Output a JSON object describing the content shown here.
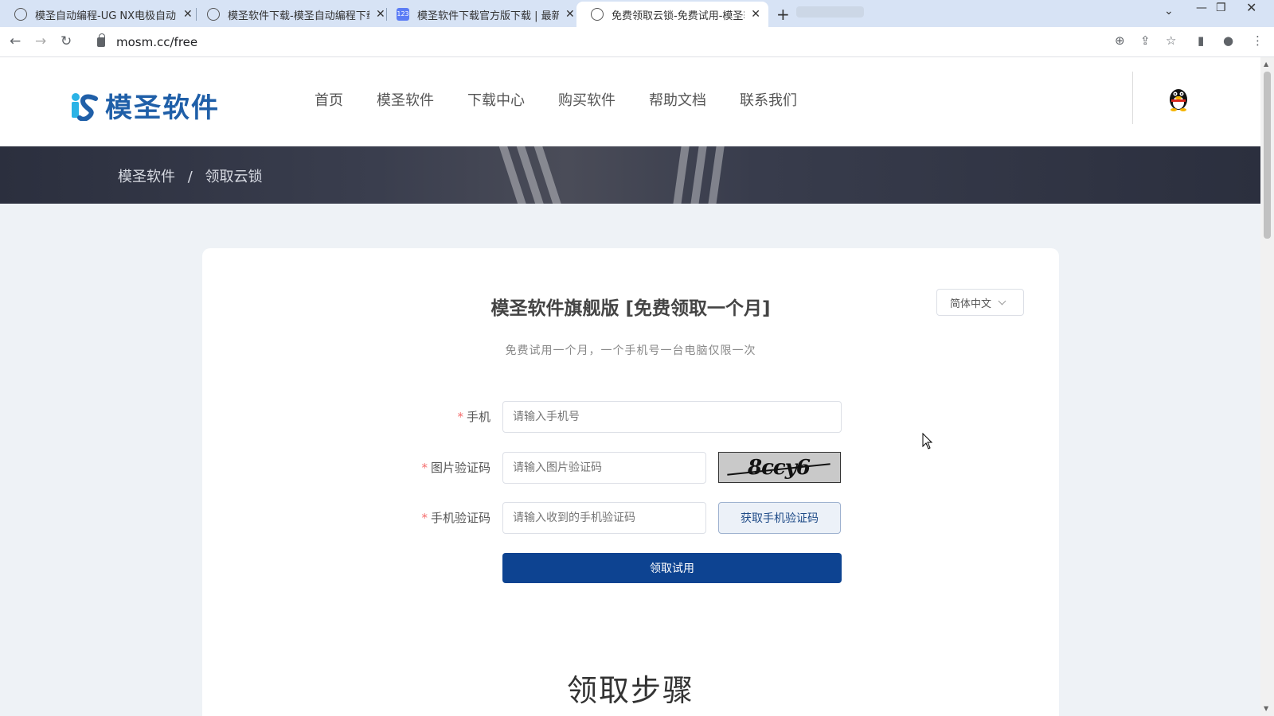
{
  "browser": {
    "tabs": [
      {
        "title": "模圣自动编程-UG NX电极自动",
        "active": false,
        "icon": "globe-icon"
      },
      {
        "title": "模圣软件下载-模圣自动编程下载",
        "active": false,
        "icon": "globe-icon"
      },
      {
        "title": "模圣软件下载官方版下载 | 最新",
        "active": false,
        "icon": "123-icon",
        "icon_text": "123"
      },
      {
        "title": "免费领取云锁-免费试用-模圣软件",
        "active": true,
        "icon": "globe-icon"
      }
    ],
    "url": "mosm.cc/free"
  },
  "site": {
    "logo_text": "模圣软件",
    "brand_color": "#1f5fa8",
    "nav": [
      "首页",
      "模圣软件",
      "下载中心",
      "购买软件",
      "帮助文档",
      "联系我们"
    ]
  },
  "breadcrumb": {
    "home": "模圣软件",
    "separator": "/",
    "current": "领取云锁"
  },
  "card": {
    "title": "模圣软件旗舰版 [免费领取一个月]",
    "language": "简体中文",
    "subtitle": "免费试用一个月，一个手机号一台电脑仅限一次",
    "fields": {
      "phone": {
        "label": "手机",
        "placeholder": "请输入手机号"
      },
      "image_code": {
        "label": "图片验证码",
        "placeholder": "请输入图片验证码",
        "captcha": "8ccy6"
      },
      "sms_code": {
        "label": "手机验证码",
        "placeholder": "请输入收到的手机验证码",
        "button": "获取手机验证码"
      }
    },
    "required_mark": "*",
    "submit": "领取试用",
    "submit_color": "#0d4391"
  },
  "steps": {
    "title": "领取步骤"
  }
}
